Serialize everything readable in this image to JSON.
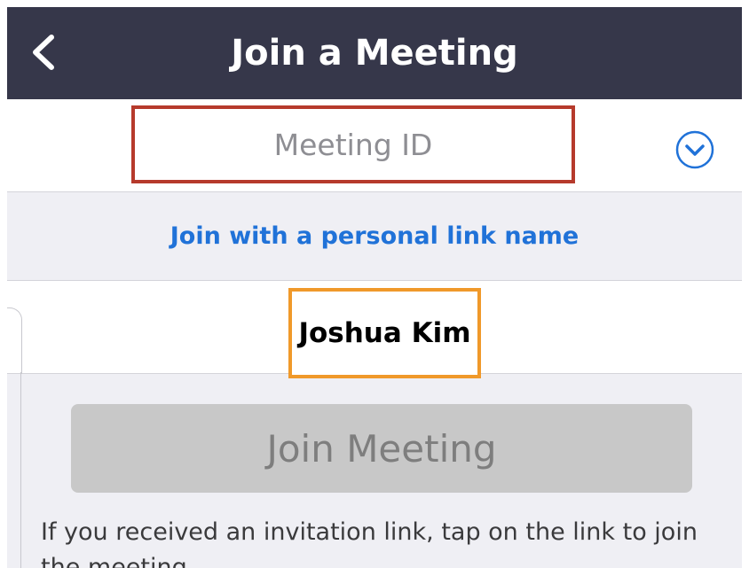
{
  "header": {
    "title": "Join a Meeting",
    "back_icon": "chevron-left-icon"
  },
  "meeting_id": {
    "placeholder": "Meeting ID",
    "dropdown_icon": "chevron-down-circle-icon",
    "highlight_color": "#b63a2c"
  },
  "personal_link": {
    "label": "Join with a personal link name",
    "color": "#2072d8"
  },
  "name_field": {
    "value": "Joshua Kim",
    "highlight_color": "#f0992a"
  },
  "join_button": {
    "label": "Join Meeting",
    "state": "disabled"
  },
  "helper_text": "If you received an invitation link, tap on the link to join the meeting."
}
